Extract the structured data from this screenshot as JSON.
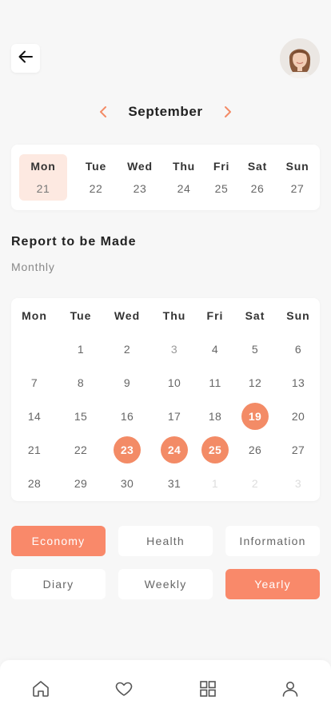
{
  "header": {
    "back_icon": "arrow-left-icon",
    "avatar": "user-avatar"
  },
  "month_nav": {
    "label": "September",
    "prev_icon": "chevron-left-icon",
    "next_icon": "chevron-right-icon",
    "accent": "#f38b66"
  },
  "week_strip": {
    "days": [
      {
        "name": "Mon",
        "num": "21",
        "active": true
      },
      {
        "name": "Tue",
        "num": "22",
        "active": false
      },
      {
        "name": "Wed",
        "num": "23",
        "active": false
      },
      {
        "name": "Thu",
        "num": "24",
        "active": false
      },
      {
        "name": "Fri",
        "num": "25",
        "active": false
      },
      {
        "name": "Sat",
        "num": "26",
        "active": false
      },
      {
        "name": "Sun",
        "num": "27",
        "active": false
      }
    ]
  },
  "report": {
    "title": "Report to be Made",
    "subtitle": "Monthly"
  },
  "calendar": {
    "headers": [
      "Mon",
      "Tue",
      "Wed",
      "Thu",
      "Fri",
      "Sat",
      "Sun"
    ],
    "rows": [
      [
        "",
        "1",
        "2",
        "3",
        "4",
        "5",
        "6"
      ],
      [
        "7",
        "8",
        "9",
        "10",
        "11",
        "12",
        "13"
      ],
      [
        "14",
        "15",
        "16",
        "17",
        "18",
        "19",
        "20"
      ],
      [
        "21",
        "22",
        "23",
        "24",
        "25",
        "26",
        "27"
      ],
      [
        "28",
        "29",
        "30",
        "31",
        "1",
        "2",
        "3"
      ]
    ],
    "highlighted": [
      "19",
      "23",
      "24",
      "25"
    ],
    "next_month_days": [
      "1",
      "2",
      "3"
    ],
    "highlight_color": "#f38b66"
  },
  "filters": {
    "items": [
      {
        "label": "Economy",
        "selected": true
      },
      {
        "label": "Health",
        "selected": false
      },
      {
        "label": "Information",
        "selected": false
      },
      {
        "label": "Diary",
        "selected": false
      },
      {
        "label": "Weekly",
        "selected": false
      },
      {
        "label": "Yearly",
        "selected": true
      }
    ],
    "selected_color": "#f9896a"
  },
  "tabbar": {
    "items": [
      "home-icon",
      "heart-icon",
      "grid-icon",
      "user-icon"
    ]
  }
}
